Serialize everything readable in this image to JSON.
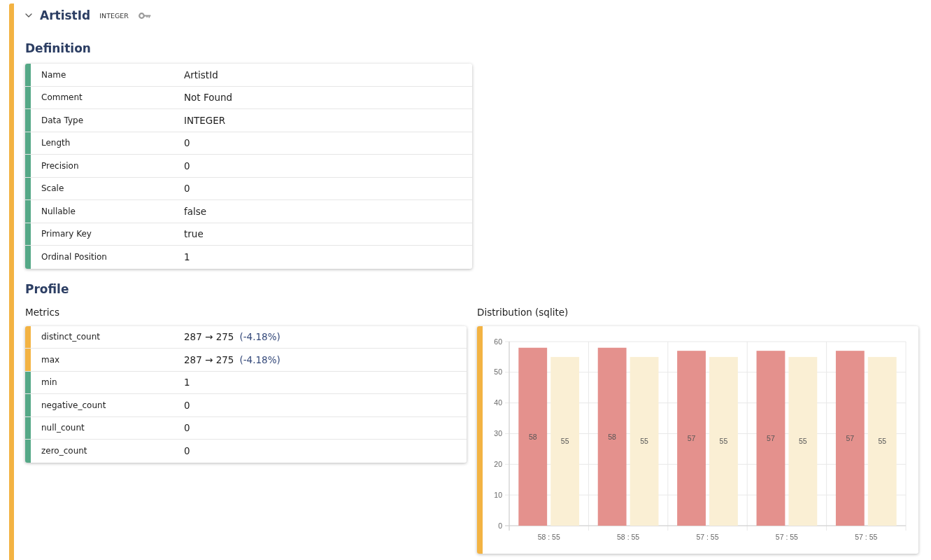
{
  "column": {
    "changed": true,
    "expanded": true,
    "name": "ArtistId",
    "type": "INTEGER",
    "primary_key": true
  },
  "definition": {
    "heading": "Definition",
    "rows": [
      {
        "label": "Name",
        "value": "ArtistId",
        "changed": false
      },
      {
        "label": "Comment",
        "value": "Not Found",
        "changed": false
      },
      {
        "label": "Data Type",
        "value": "INTEGER",
        "changed": false
      },
      {
        "label": "Length",
        "value": "0",
        "changed": false
      },
      {
        "label": "Precision",
        "value": "0",
        "changed": false
      },
      {
        "label": "Scale",
        "value": "0",
        "changed": false
      },
      {
        "label": "Nullable",
        "value": "false",
        "changed": false
      },
      {
        "label": "Primary Key",
        "value": "true",
        "changed": false
      },
      {
        "label": "Ordinal Position",
        "value": "1",
        "changed": false
      }
    ]
  },
  "profile": {
    "heading": "Profile",
    "metrics": {
      "title": "Metrics",
      "rows": [
        {
          "label": "distinct_count",
          "value": "287 → 275",
          "delta": "(-4.18%)",
          "changed": true
        },
        {
          "label": "max",
          "value": "287 → 275",
          "delta": "(-4.18%)",
          "changed": true
        },
        {
          "label": "min",
          "value": "1",
          "changed": false
        },
        {
          "label": "negative_count",
          "value": "0",
          "changed": false
        },
        {
          "label": "null_count",
          "value": "0",
          "changed": false
        },
        {
          "label": "zero_count",
          "value": "0",
          "changed": false
        }
      ]
    },
    "distribution": {
      "title": "Distribution (sqlite)",
      "changed": true,
      "chart_data": {
        "type": "bar",
        "categories": [
          "58 : 55",
          "58 : 55",
          "57 : 55",
          "57 : 55",
          "57 : 55"
        ],
        "series": [
          {
            "color": "#e4918d",
            "values": [
              58,
              58,
              57,
              57,
              57
            ]
          },
          {
            "color": "#faefd4",
            "values": [
              55,
              55,
              55,
              55,
              55
            ]
          }
        ],
        "ylim": [
          0,
          60
        ],
        "yticks": [
          0,
          10,
          20,
          30,
          40,
          50,
          60
        ],
        "grid": true,
        "data_labels": true
      }
    }
  }
}
